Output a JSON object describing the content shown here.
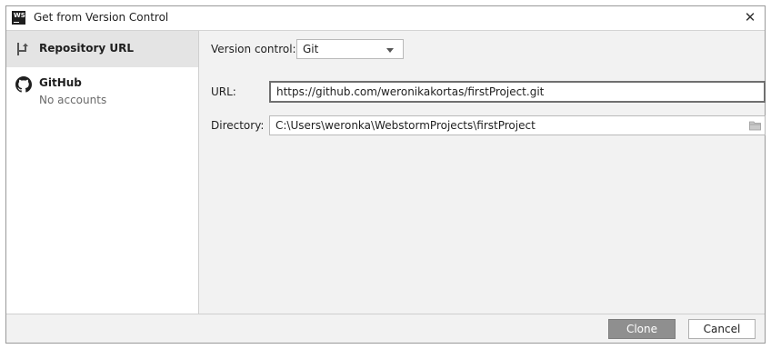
{
  "window": {
    "title": "Get from Version Control",
    "logo_text": "WS",
    "close_glyph": "✕"
  },
  "sidebar": {
    "items": [
      {
        "label": "Repository URL",
        "icon": "repository-url-icon",
        "selected": true
      },
      {
        "label": "GitHub",
        "sublabel": "No accounts",
        "icon": "github-icon",
        "selected": false
      }
    ]
  },
  "form": {
    "version_control_label": "Version control:",
    "version_control_value": "Git",
    "url_label": "URL:",
    "url_value": "https://github.com/weronikakortas/firstProject.git",
    "directory_label": "Directory:",
    "directory_value": "C:\\Users\\weronka\\WebstormProjects\\firstProject"
  },
  "footer": {
    "clone_label": "Clone",
    "cancel_label": "Cancel"
  },
  "colors": {
    "selected_item_bg": "#e4e4e4",
    "clone_button_bg": "#8f8f8f",
    "dialog_bg": "#f2f2f2"
  }
}
